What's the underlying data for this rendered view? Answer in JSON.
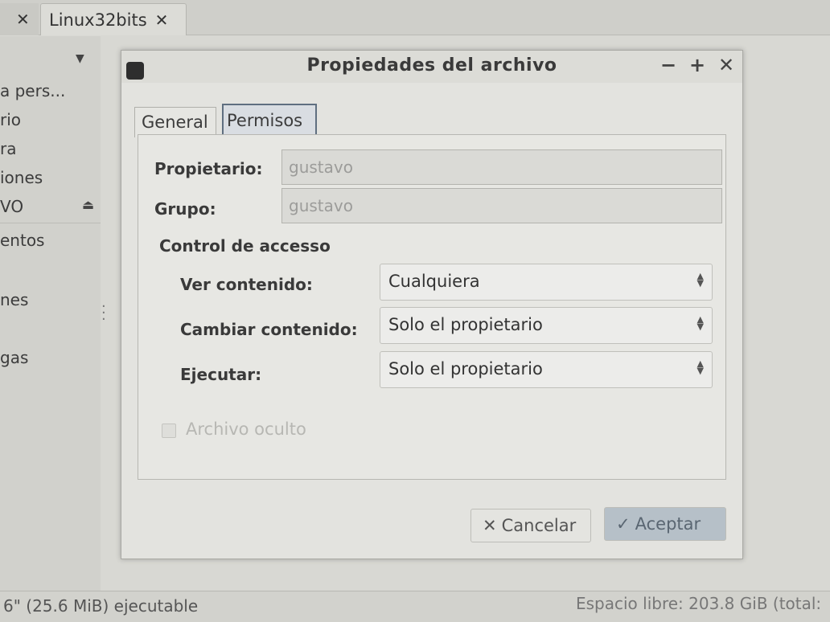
{
  "file_manager": {
    "tabs": [
      {
        "label": "",
        "close": "✕"
      },
      {
        "label": "Linux32bits",
        "close": "✕"
      }
    ],
    "sidebar": {
      "items": [
        {
          "label": "a pers..."
        },
        {
          "label": "rio"
        },
        {
          "label": "ra"
        },
        {
          "label": "iones"
        },
        {
          "label": "VO"
        },
        {
          "label": "entos"
        },
        {
          "label": "nes"
        },
        {
          "label": "gas"
        }
      ]
    },
    "statusbar": {
      "left": "6\" (25.6 MiB) ejecutable",
      "right": "Espacio libre: 203.8 GiB (total:"
    }
  },
  "dialog": {
    "title": "Propiedades del archivo",
    "window_buttons": {
      "minimize": "−",
      "maximize": "+",
      "close": "✕"
    },
    "tabs": [
      {
        "label": "General",
        "active": false
      },
      {
        "label": "Permisos",
        "active": true
      }
    ],
    "owner": {
      "label": "Propietario:",
      "value": "gustavo"
    },
    "group": {
      "label": "Grupo:",
      "value": "gustavo"
    },
    "access_control": {
      "heading": "Control de accesso",
      "rows": [
        {
          "label": "Ver contenido:",
          "value": "Cualquiera"
        },
        {
          "label": "Cambiar contenido:",
          "value": "Solo el propietario"
        },
        {
          "label": "Ejecutar:",
          "value": "Solo el propietario"
        }
      ]
    },
    "hidden_file": {
      "label": "Archivo oculto",
      "checked": false,
      "enabled": false
    },
    "buttons": {
      "cancel": {
        "icon": "✕",
        "label": "Cancelar"
      },
      "ok": {
        "icon": "✓",
        "label": "Aceptar"
      }
    }
  },
  "colors": {
    "accent_tab_border": "#5f6f80",
    "ok_button_bg": "#b6c0c8",
    "disabled_text": "#b7b7b3"
  }
}
